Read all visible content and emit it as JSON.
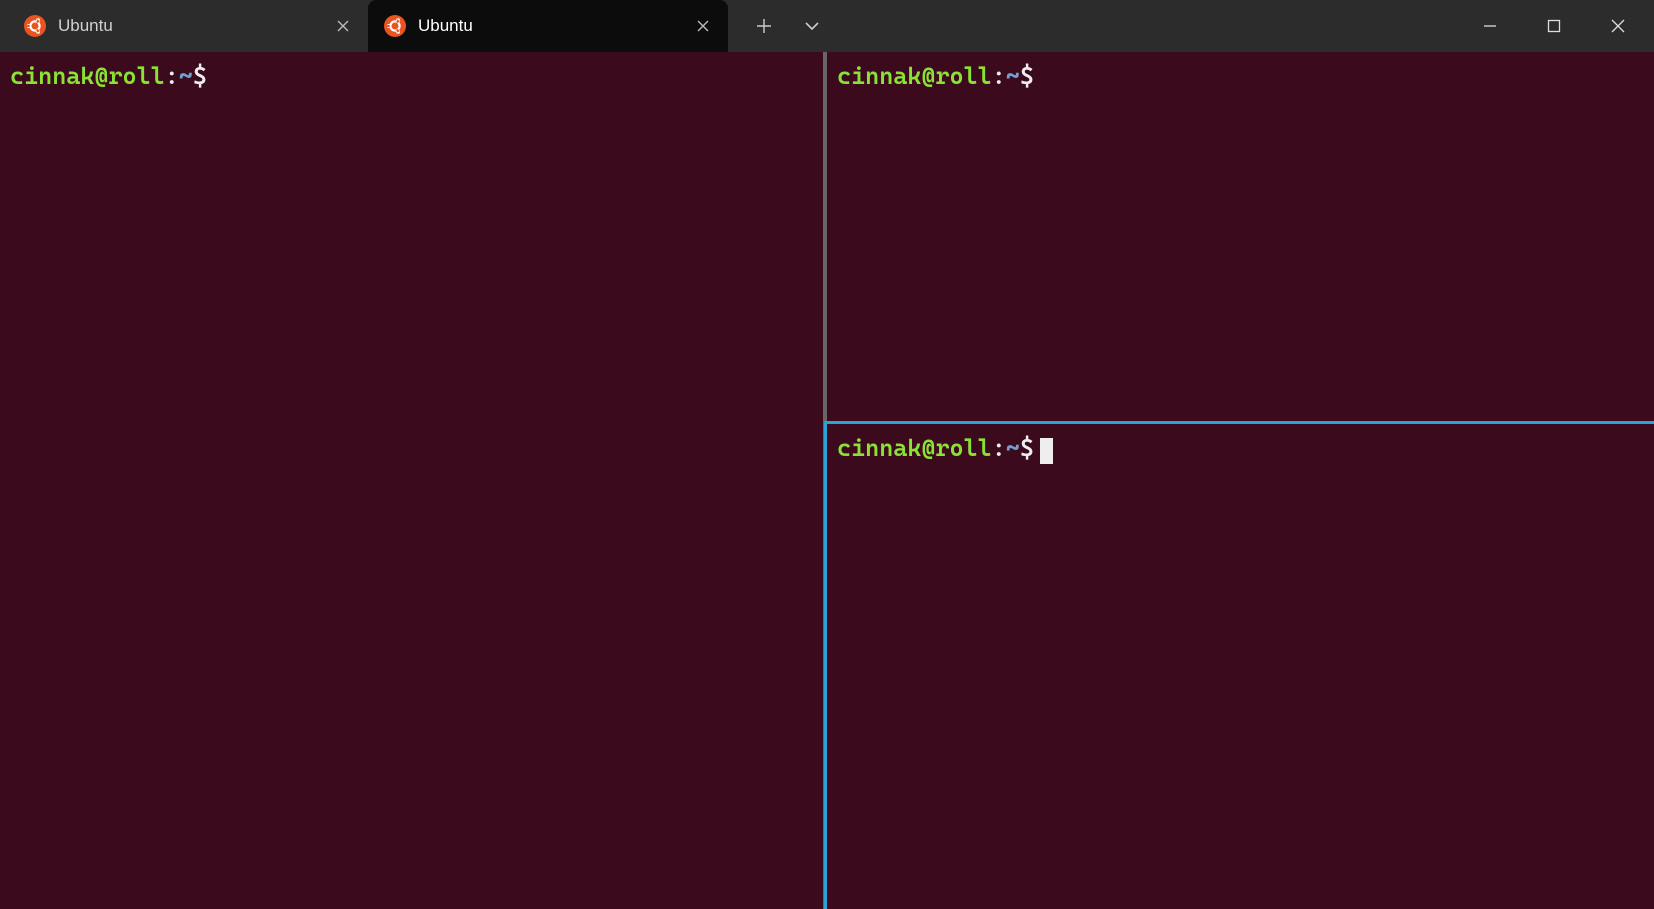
{
  "tabs": [
    {
      "title": "Ubuntu",
      "active": false
    },
    {
      "title": "Ubuntu",
      "active": true
    }
  ],
  "prompt": {
    "user_host": "cinnak@roll",
    "colon": ":",
    "path": "~",
    "dollar": "$"
  },
  "panes": {
    "left": {
      "has_cursor": false
    },
    "right_top": {
      "has_cursor": false
    },
    "right_bottom": {
      "has_cursor": true
    }
  }
}
